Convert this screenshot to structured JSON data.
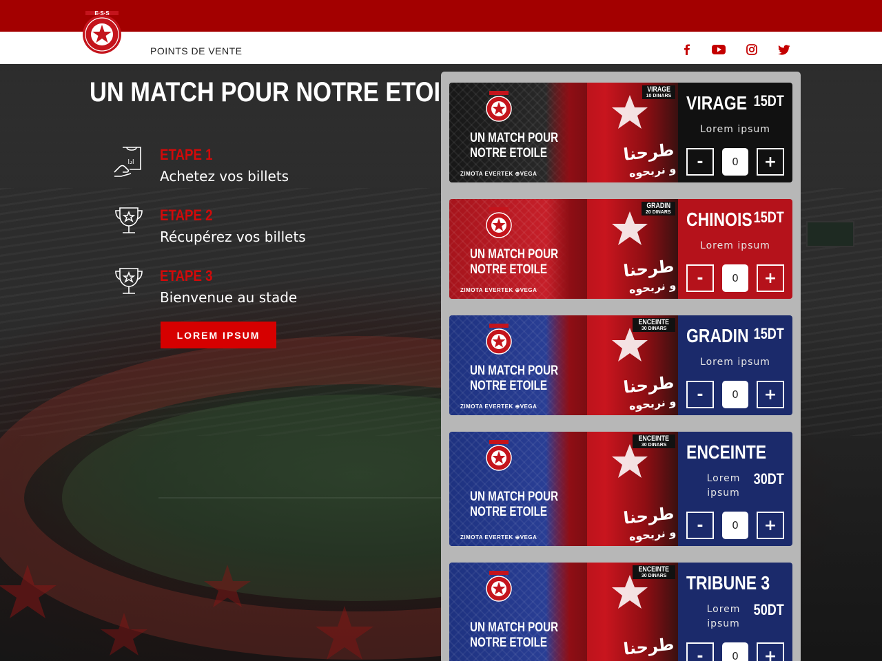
{
  "nav": {
    "link": "POINTS DE VENTE",
    "social": [
      "facebook-icon",
      "youtube-icon",
      "instagram-icon",
      "twitter-icon"
    ]
  },
  "logo": {
    "text": "E·S·S"
  },
  "hero": {
    "title": "UN MATCH POUR NOTRE ETOILE",
    "cta": "LOREM IPSUM",
    "steps": [
      {
        "label": "ETAPE 1",
        "text": "Achetez vos billets",
        "icon": "ticket-hand-icon"
      },
      {
        "label": "ETAPE 2",
        "text": "Récupérez vos billets",
        "icon": "trophy-icon"
      },
      {
        "label": "ETAPE 3",
        "text": "Bienvenue au stade",
        "icon": "trophy-icon"
      }
    ]
  },
  "tickets": [
    {
      "name": "VIRAGE",
      "price": "15DT",
      "desc": "Lorem ipsum",
      "qty": "0",
      "tag1": "VIRAGE",
      "tag2": "10 DINARS"
    },
    {
      "name": "CHINOIS",
      "price": "15DT",
      "desc": "Lorem ipsum",
      "qty": "0",
      "tag1": "GRADIN",
      "tag2": "20 DINARS"
    },
    {
      "name": "GRADIN",
      "price": "15DT",
      "desc": "Lorem ipsum",
      "qty": "0",
      "tag1": "ENCEINTE",
      "tag2": "30 DINARS"
    },
    {
      "name": "ENCEINTE",
      "price": "30DT",
      "desc": "Lorem ipsum",
      "qty": "0",
      "tag1": "ENCEINTE",
      "tag2": "30 DINARS"
    },
    {
      "name": "TRIBUNE 3",
      "price": "50DT",
      "desc": "Lorem ipsum",
      "qty": "0",
      "tag1": "ENCEINTE",
      "tag2": "30 DINARS"
    }
  ],
  "art": {
    "line1": "UN MATCH POUR",
    "line2": "NOTRE ETOILE",
    "sponsors": "ZIMOTA   EVERTEK   ⊕VEGA",
    "arabic1": "طرحنا",
    "arabic2": "و نربحوه",
    "minus": "-",
    "plus": "+"
  },
  "colors": {
    "brand_red": "#a30000",
    "cta_red": "#d60000",
    "step_red": "#d10a0a",
    "virage_card": "#111111",
    "chinois_card": "#b5121b",
    "blue_card": "#1b2a6b"
  }
}
